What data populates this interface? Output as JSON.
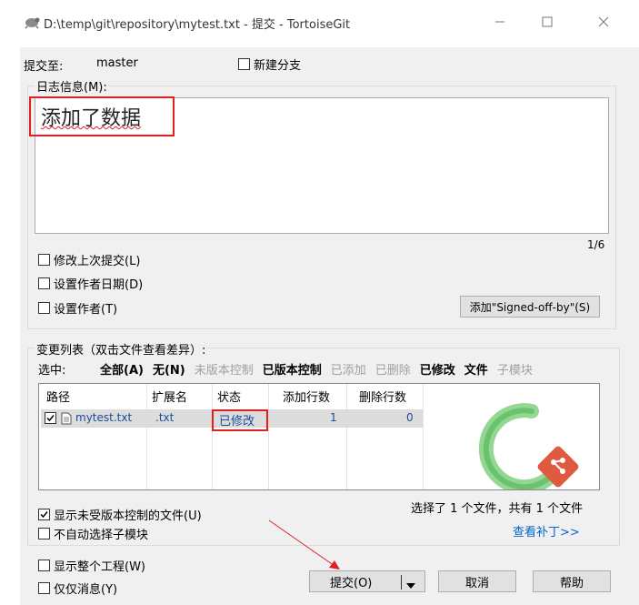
{
  "window": {
    "title": "D:\\temp\\git\\repository\\mytest.txt - 提交 - TortoiseGit"
  },
  "commit_to": {
    "label": "提交至:",
    "branch": "master",
    "new_branch_label": "新建分支"
  },
  "log_message": {
    "group_label": "日志信息(M):",
    "text": "添加了数据",
    "counter": "1/6"
  },
  "options": {
    "amend_label": "修改上次提交(L)",
    "set_date_label": "设置作者日期(D)",
    "set_author_label": "设置作者(T)",
    "signed_off_button": "添加\"Signed-off-by\"(S)"
  },
  "changes": {
    "group_label": "变更列表（双击文件查看差异）:",
    "select_label": "选中:",
    "filters": [
      {
        "label": "全部(A)",
        "enabled": true
      },
      {
        "label": "无(N)",
        "enabled": true
      },
      {
        "label": "未版本控制",
        "enabled": false
      },
      {
        "label": "已版本控制",
        "enabled": true
      },
      {
        "label": "已添加",
        "enabled": false
      },
      {
        "label": "已删除",
        "enabled": false
      },
      {
        "label": "已修改",
        "enabled": true
      },
      {
        "label": "文件",
        "enabled": true
      },
      {
        "label": "子模块",
        "enabled": false
      }
    ],
    "columns": [
      "路径",
      "扩展名",
      "状态",
      "添加行数",
      "删除行数"
    ],
    "rows": [
      {
        "path": "mytest.txt",
        "ext": ".txt",
        "status": "已修改",
        "added": "1",
        "deleted": "0",
        "checked": true
      }
    ],
    "show_unversioned_label": "显示未受版本控制的文件(U)",
    "no_autoselect_label": "不自动选择子模块",
    "summary": "选择了 1 个文件，共有 1 个文件",
    "view_patch_link": "查看补丁>>"
  },
  "bottom": {
    "show_whole_project_label": "显示整个工程(W)",
    "message_only_label": "仅仅消息(Y)",
    "commit_button": "提交(O)",
    "cancel_button": "取消",
    "help_button": "帮助"
  },
  "colors": {
    "annotation_red": "#e02020",
    "link_blue": "#0066cc",
    "selected_row": "#cce8ff",
    "logo_green": "#4caf50",
    "logo_red": "#e05a40"
  }
}
